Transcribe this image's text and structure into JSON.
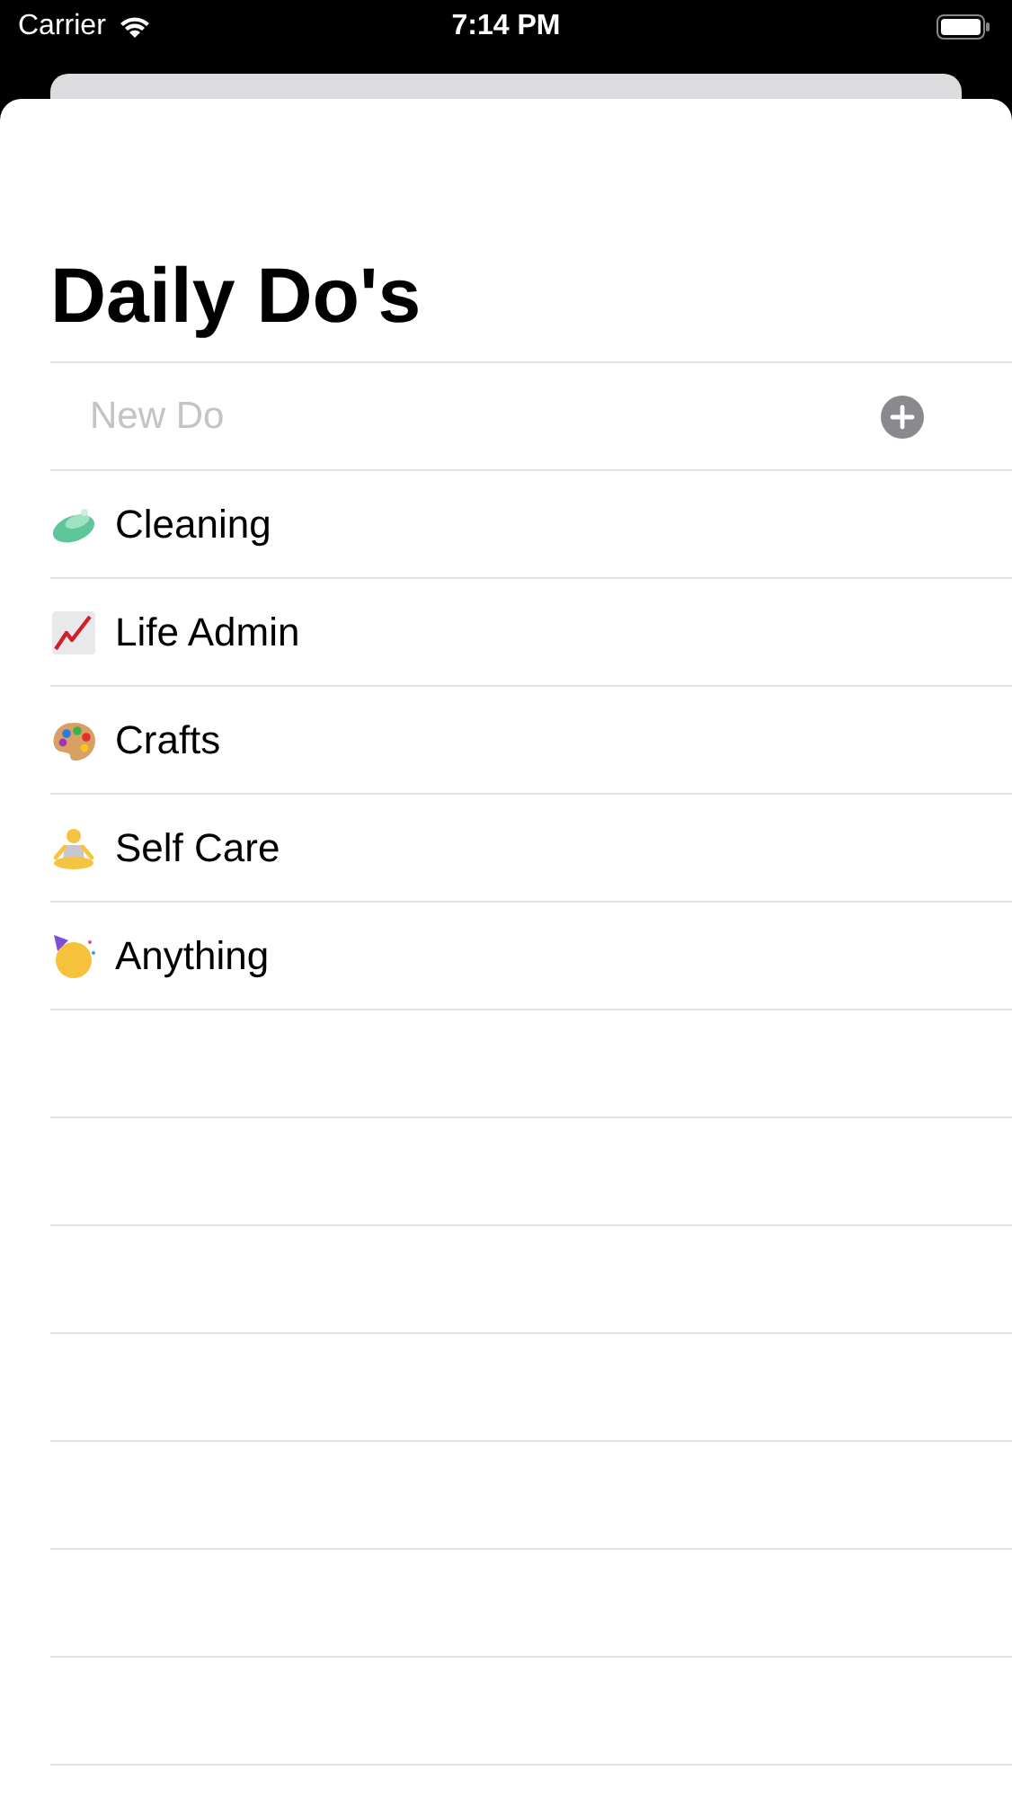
{
  "status_bar": {
    "carrier": "Carrier",
    "time": "7:14 PM"
  },
  "title": "Daily Do's",
  "new_item": {
    "placeholder": "New Do"
  },
  "items": [
    {
      "label": "Cleaning"
    },
    {
      "label": "Life Admin"
    },
    {
      "label": "Crafts"
    },
    {
      "label": "Self Care"
    },
    {
      "label": "Anything"
    }
  ]
}
